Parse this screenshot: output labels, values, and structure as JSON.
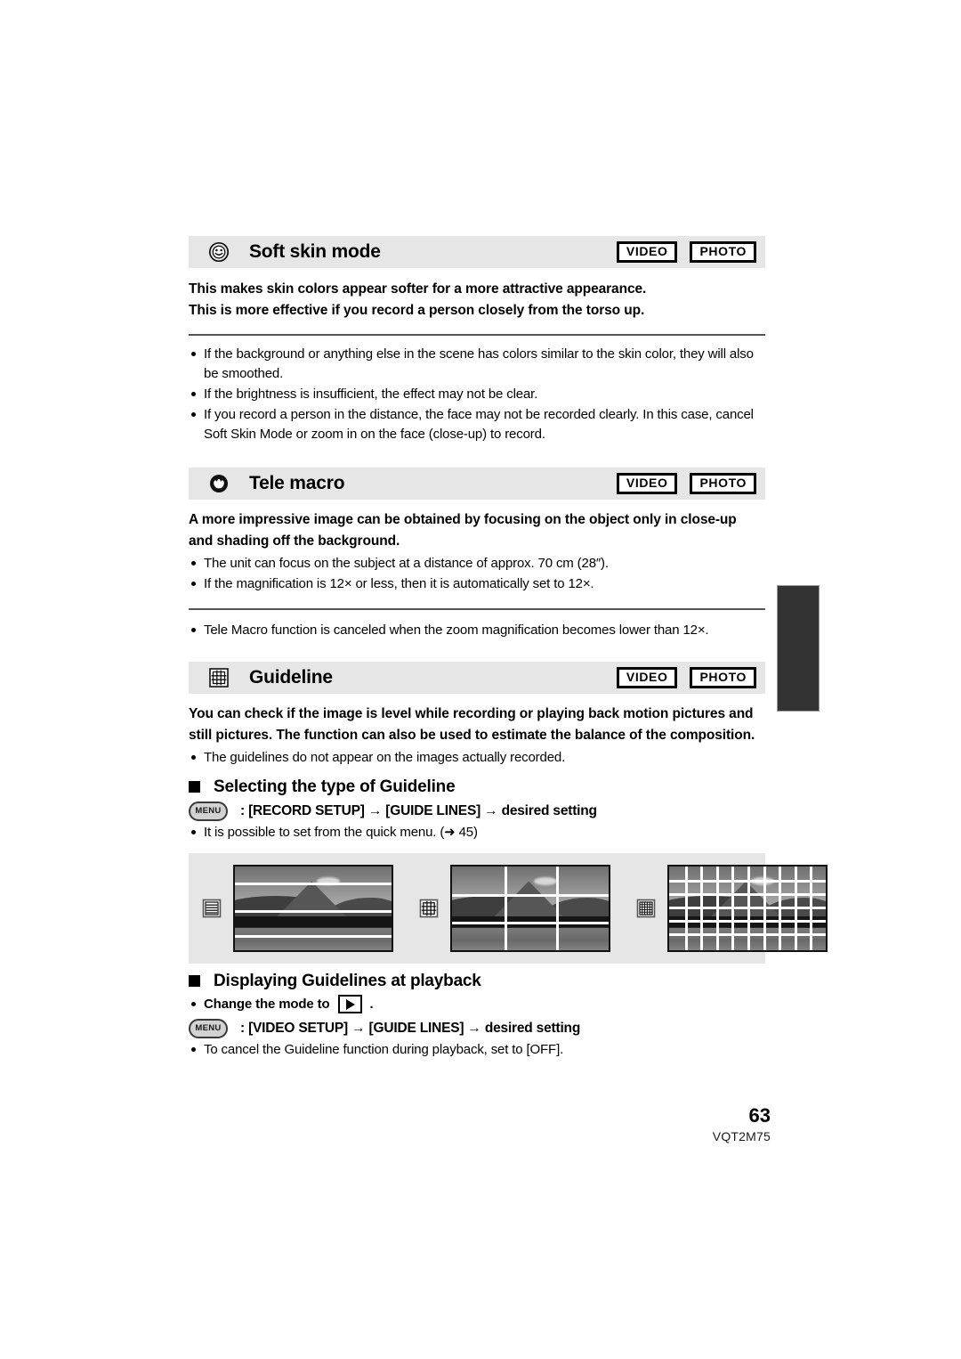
{
  "document": {
    "page_number": "63",
    "doc_id": "VQT2M75"
  },
  "sections": [
    {
      "icon": "smiley-face-icon",
      "title": "Soft skin mode",
      "badges": [
        "VIDEO",
        "PHOTO"
      ],
      "lead_line_1": "This makes skin colors appear softer for a more attractive appearance.",
      "lead_line_2": "This is more effective if you record a person closely from the torso up.",
      "notes": [
        "If the background or anything else in the scene has colors similar to the skin color, they will also be smoothed.",
        "If the brightness is insufficient, the effect may not be clear.",
        "If you record a person in the distance, the face may not be recorded clearly. In this case, cancel Soft Skin Mode or zoom in on the face (close-up) to record."
      ]
    },
    {
      "icon": "tele-macro-flower-icon",
      "title": "Tele macro",
      "badges": [
        "VIDEO",
        "PHOTO"
      ],
      "lead_line_1": "A more impressive image can be obtained by focusing on the object only in close-up",
      "lead_line_2": "and shading off the background.",
      "notes": [
        "The unit can focus on the subject at a distance of approx. 70 cm (28″).",
        "If the magnification is 12× or less, then it is automatically set to 12×."
      ],
      "after_rule_notes": [
        "Tele Macro function is canceled when the zoom magnification becomes lower than 12×."
      ]
    },
    {
      "icon": "guideline-grid-icon",
      "title": "Guideline",
      "badges": [
        "VIDEO",
        "PHOTO"
      ],
      "lead_paragraph": "You can check if the image is level while recording or playing back motion pictures and still pictures. The function can also be used to estimate the balance of the composition.",
      "notes": [
        "The guidelines do not appear on the images actually recorded."
      ],
      "sub_sections": [
        {
          "heading": "Selecting the type of Guideline",
          "menu_button_label": "MENU",
          "menu_path_prefix": ": [RECORD SETUP] ",
          "menu_path_arrow_1": "→",
          "menu_path_middle": " [GUIDE LINES] ",
          "menu_path_arrow_2": "→",
          "menu_path_suffix": " desired setting",
          "notes": [
            "It is possible to set from the quick menu. (➜ 45)"
          ]
        },
        {
          "heading": "Displaying Guidelines at playback",
          "pre_note_prefix": "Change the mode to",
          "pre_note_icon": "playback-mode-icon",
          "pre_note_suffix": ".",
          "menu_button_label": "MENU",
          "menu_path_prefix": ": [VIDEO SETUP] ",
          "menu_path_arrow_1": "→",
          "menu_path_middle": " [GUIDE LINES] ",
          "menu_path_arrow_2": "→",
          "menu_path_suffix": " desired setting",
          "notes": [
            "To cancel the Guideline function during playback, set to [OFF]."
          ]
        }
      ],
      "samples": [
        {
          "icon": "horizontal-lines-icon",
          "type": "horizontal-lines",
          "alt": "landscape photo with horizontal guidelines"
        },
        {
          "icon": "rule-of-thirds-grid-icon",
          "type": "thirds-grid",
          "alt": "landscape photo with 3x3 grid guidelines"
        },
        {
          "icon": "fine-grid-icon",
          "type": "fine-grid",
          "alt": "landscape photo with fine grid guidelines"
        }
      ]
    }
  ],
  "colors": {
    "header_band": "#e6e6e6",
    "edge_tab": "#333333",
    "text": "#000000"
  }
}
